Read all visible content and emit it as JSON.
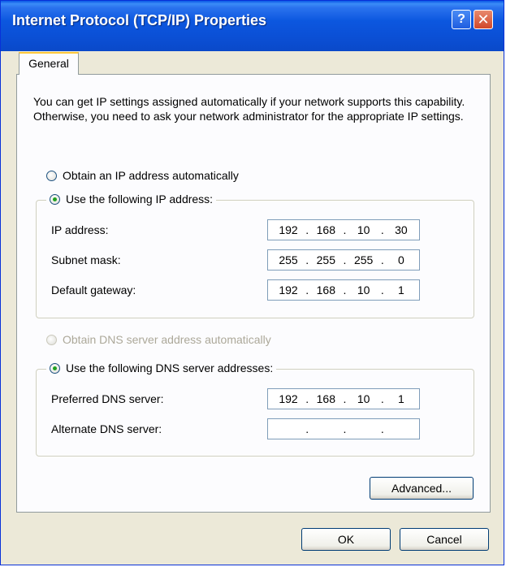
{
  "window": {
    "title": "Internet Protocol (TCP/IP) Properties",
    "help_label": "?",
    "close_label": "✕"
  },
  "tabs": [
    {
      "label": "General",
      "active": true
    }
  ],
  "general": {
    "description": "You can get IP settings assigned automatically if your network supports this capability. Otherwise, you need to ask your network administrator for the appropriate IP settings.",
    "ip_mode": {
      "auto_label": "Obtain an IP address automatically",
      "auto_selected": false,
      "manual_label": "Use the following IP address:",
      "manual_selected": true
    },
    "ip_fields": [
      {
        "label": "IP address:",
        "octets": [
          "192",
          "168",
          "10",
          "30"
        ]
      },
      {
        "label": "Subnet mask:",
        "octets": [
          "255",
          "255",
          "255",
          "0"
        ]
      },
      {
        "label": "Default gateway:",
        "octets": [
          "192",
          "168",
          "10",
          "1"
        ]
      }
    ],
    "dns_mode": {
      "auto_label": "Obtain DNS server address automatically",
      "auto_enabled": false,
      "manual_label": "Use the following DNS server addresses:",
      "manual_selected": true
    },
    "dns_fields": [
      {
        "label": "Preferred DNS server:",
        "octets": [
          "192",
          "168",
          "10",
          "1"
        ]
      },
      {
        "label": "Alternate DNS server:",
        "octets": [
          "",
          "",
          "",
          ""
        ]
      }
    ],
    "advanced_label": "Advanced..."
  },
  "buttons": {
    "ok": "OK",
    "cancel": "Cancel"
  },
  "colors": {
    "title_bar": "#0b50d6",
    "selected_radio": "#21a121",
    "tab_highlight": "#ffc73c"
  }
}
